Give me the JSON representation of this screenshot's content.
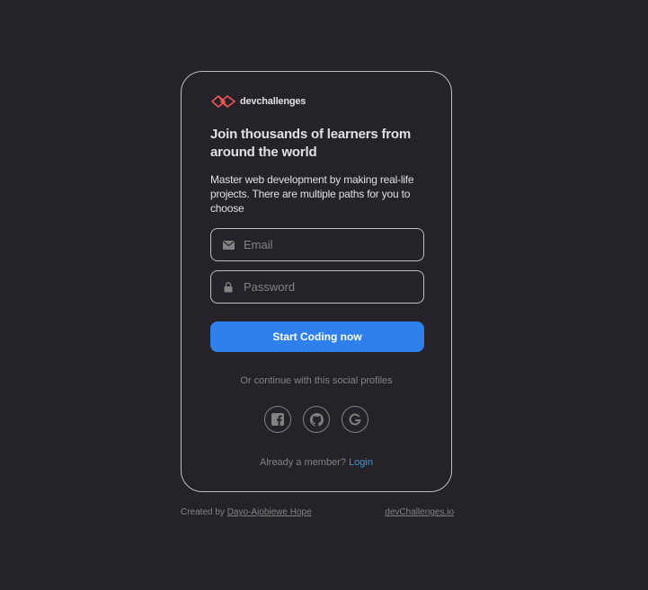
{
  "brand": {
    "name": "devchallenges",
    "accent": "#EB5757"
  },
  "card": {
    "heading": "Join thousands of learners from around the world",
    "subtext": "Master web development by making real-life projects. There are multiple paths for you to choose"
  },
  "form": {
    "email_placeholder": "Email",
    "email_value": "",
    "email_icon": "envelope-icon",
    "password_placeholder": "Password",
    "password_value": "",
    "password_icon": "lock-icon",
    "submit_label": "Start Coding now"
  },
  "social": {
    "caption": "Or continue with this social profiles",
    "providers": [
      {
        "icon": "facebook-icon"
      },
      {
        "icon": "github-icon"
      },
      {
        "icon": "google-icon"
      }
    ]
  },
  "member": {
    "prompt": "Already a member?",
    "login_label": "Login"
  },
  "footer": {
    "created_by_prefix": "Created by",
    "author": "Dayo-Ajobiewe Hope",
    "site": "devChallenges.io"
  },
  "colors": {
    "background": "#252329",
    "primary": "#2F80ED",
    "link": "#2D9CDB",
    "text": "#E0E0E0",
    "muted": "#828282",
    "border": "#BDBDBD"
  }
}
